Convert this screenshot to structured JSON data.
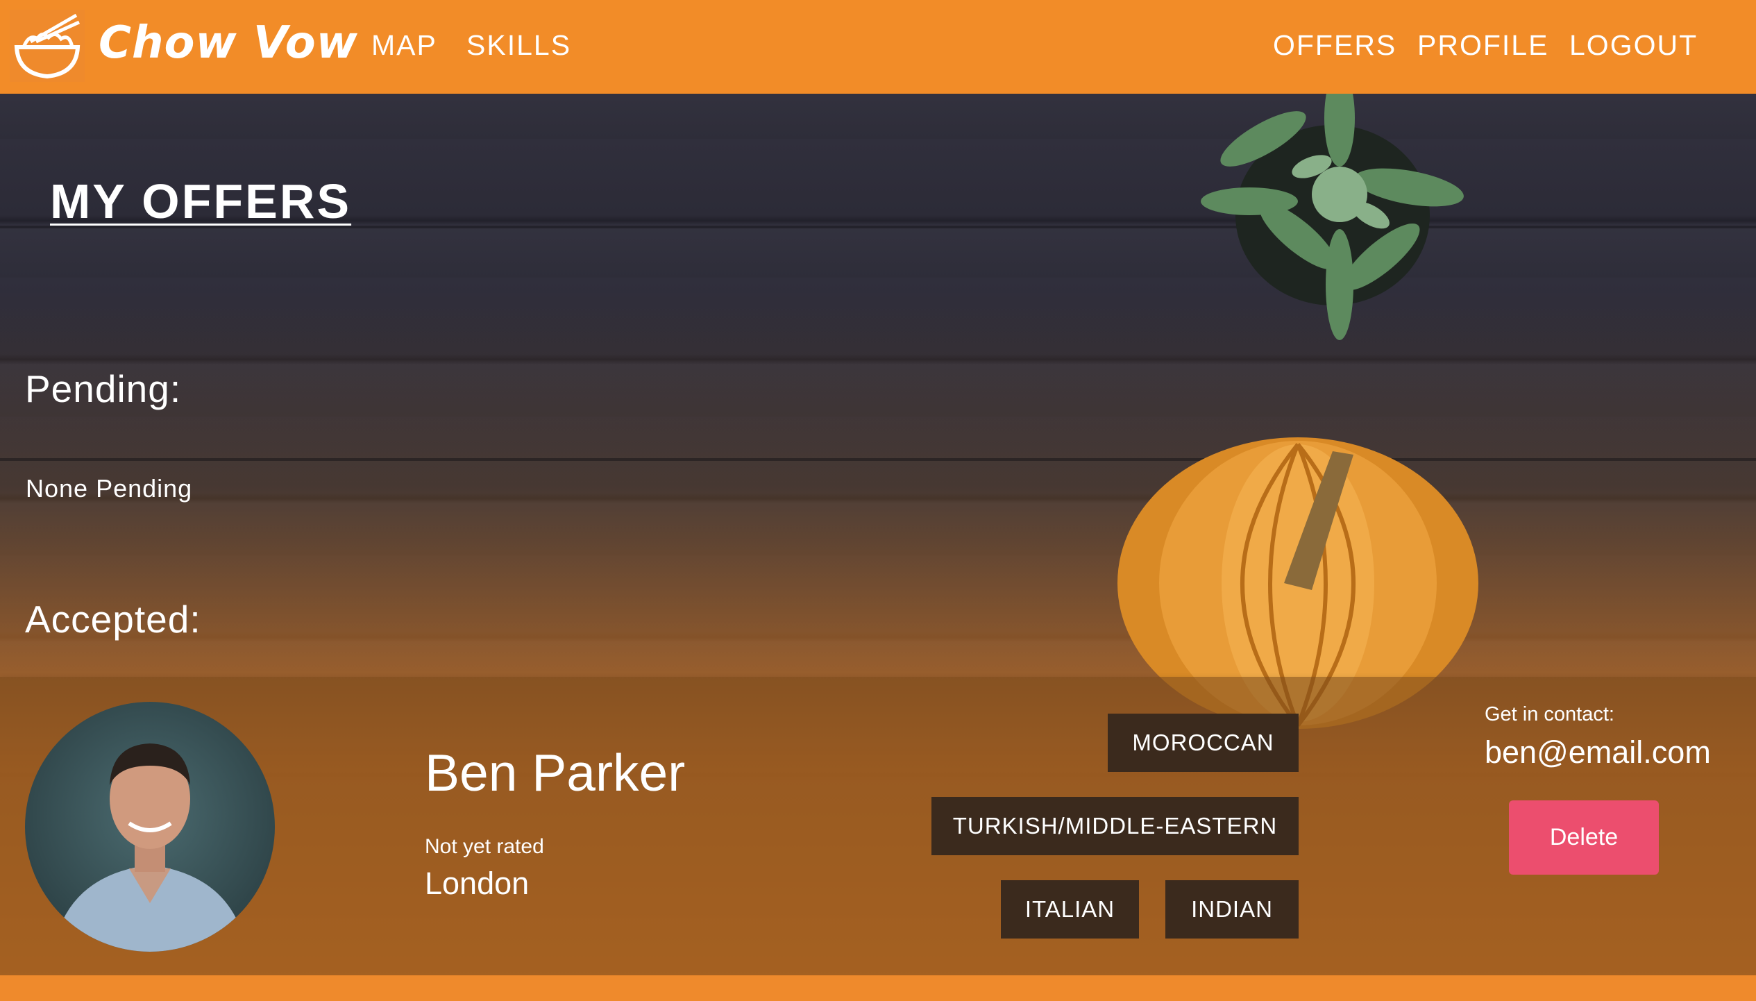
{
  "header": {
    "brand": "Chow Vow",
    "nav_left": [
      "MAP",
      "SKILLS"
    ],
    "nav_right": [
      "OFFERS",
      "PROFILE",
      "LOGOUT"
    ]
  },
  "main": {
    "title": "MY OFFERS",
    "pending_heading": "Pending:",
    "pending_status": "None Pending",
    "accepted_heading": "Accepted:"
  },
  "offer": {
    "name": "Ben Parker",
    "rating": "Not yet rated",
    "city": "London",
    "cuisines": [
      "MOROCCAN",
      "TURKISH/MIDDLE-EASTERN",
      "ITALIAN",
      "INDIAN"
    ],
    "contact_label": "Get in contact:",
    "email": "ben@email.com",
    "delete_label": "Delete"
  },
  "colors": {
    "navbar": "#f28c28",
    "tag_bg": "#3b2a1d",
    "delete_button": "#ec4e6e"
  }
}
